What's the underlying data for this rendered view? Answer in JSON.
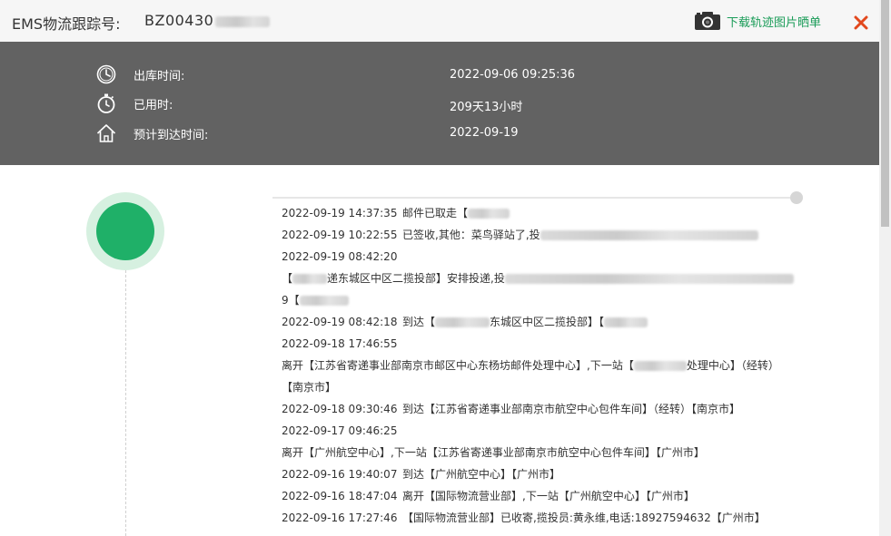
{
  "header": {
    "title": "EMS物流跟踪号:",
    "tracking_number": "BZ00430",
    "download_label": "下载轨迹图片晒单"
  },
  "summary": {
    "rows": [
      {
        "icon": "clock-icon",
        "label": "出库时间:",
        "value": "2022-09-06 09:25:36"
      },
      {
        "icon": "stopwatch-icon",
        "label": "已用时:",
        "value": "209天13小时"
      },
      {
        "icon": "home-icon",
        "label": "预计到达时间:",
        "value": "2022-09-19"
      }
    ]
  },
  "events": [
    {
      "time": "2022-09-19 14:37:35",
      "text": "邮件已取走【"
    },
    {
      "time": "2022-09-19 10:22:55",
      "text": "已签收,其他：菜鸟驿站了,投"
    },
    {
      "time": "2022-09-19 08:42:20",
      "text": ""
    },
    {
      "time": "",
      "text_a": "【",
      "text_b": "递东城区中区二揽投部】安排投递,投"
    },
    {
      "time": "",
      "text": "9【"
    },
    {
      "time": "2022-09-19 08:42:18",
      "text_a": "到达【",
      "text_b": "东城区中区二揽投部】【"
    },
    {
      "time": "2022-09-18 17:46:55",
      "text": ""
    },
    {
      "time": "",
      "text_a": "离开【江苏省寄递事业部南京市邮区中心东杨坊邮件处理中心】,下一站【",
      "text_b": "处理中心】（经转）"
    },
    {
      "time": "",
      "text": "【南京市】"
    },
    {
      "time": "2022-09-18 09:30:46",
      "text": "到达【江苏省寄递事业部南京市航空中心包件车间】（经转）【南京市】"
    },
    {
      "time": "2022-09-17 09:46:25",
      "text": ""
    },
    {
      "time": "",
      "text": "离开【广州航空中心】,下一站【江苏省寄递事业部南京市航空中心包件车间】【广州市】"
    },
    {
      "time": "2022-09-16 19:40:07",
      "text": "到达【广州航空中心】【广州市】"
    },
    {
      "time": "2022-09-16 18:47:04",
      "text": "离开【国际物流营业部】,下一站【广州航空中心】【广州市】"
    },
    {
      "time": "2022-09-16 17:27:46",
      "text": "【国际物流营业部】已收寄,揽投员:黄永维,电话:18927594632【广州市】"
    }
  ],
  "colors": {
    "accent_green": "#1a9c58",
    "dot_green": "#1fb068",
    "close_red": "#e2481d",
    "summary_bg": "#626262"
  }
}
